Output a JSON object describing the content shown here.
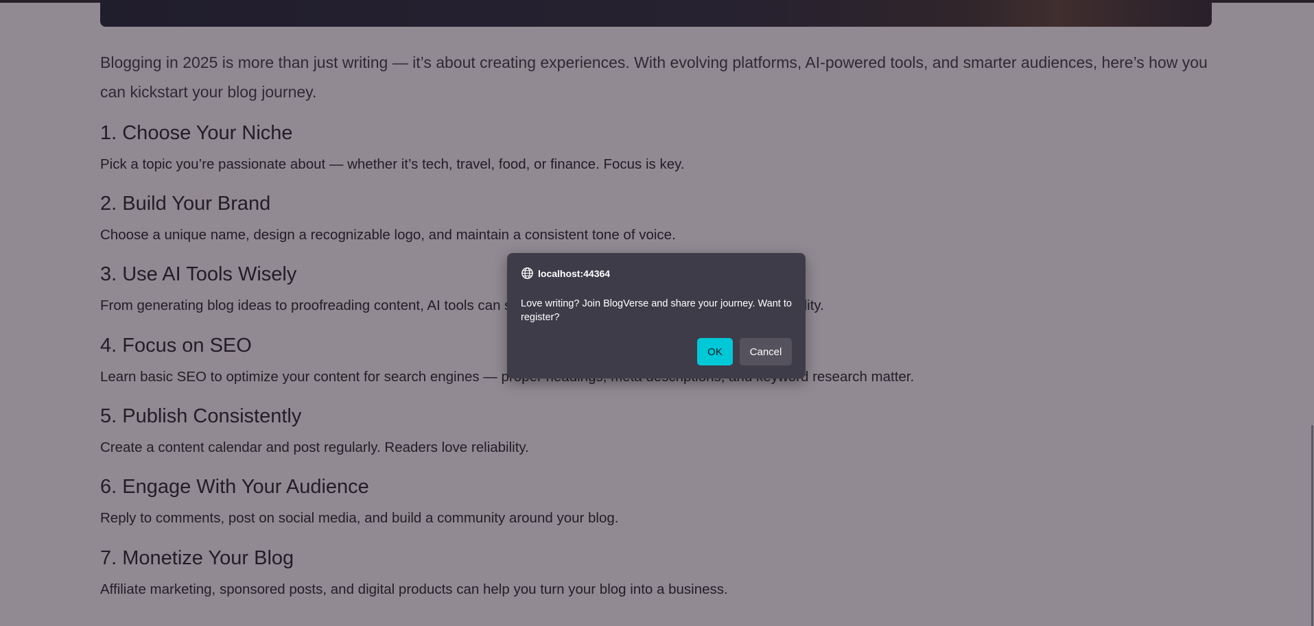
{
  "article": {
    "intro": "Blogging in 2025 is more than just writing — it’s about creating experiences. With evolving platforms, AI-powered tools, and smarter audiences, here’s how you can kickstart your blog journey.",
    "sections": [
      {
        "heading": "1. Choose Your Niche",
        "text": "Pick a topic you’re passionate about — whether it’s tech, travel, food, or finance. Focus is key."
      },
      {
        "heading": "2. Build Your Brand",
        "text": "Choose a unique name, design a recognizable logo, and maintain a consistent tone of voice."
      },
      {
        "heading": "3. Use AI Tools Wisely",
        "text": "From generating blog ideas to proofreading content, AI tools can significantly improve your writing speed and quality."
      },
      {
        "heading": "4. Focus on SEO",
        "text": "Learn basic SEO to optimize your content for search engines — proper headings, meta descriptions, and keyword research matter."
      },
      {
        "heading": "5. Publish Consistently",
        "text": "Create a content calendar and post regularly. Readers love reliability."
      },
      {
        "heading": "6. Engage With Your Audience",
        "text": "Reply to comments, post on social media, and build a community around your blog."
      },
      {
        "heading": "7. Monetize Your Blog",
        "text": "Affiliate marketing, sponsored posts, and digital products can help you turn your blog into a business."
      }
    ]
  },
  "dialog": {
    "origin": "localhost:44364",
    "origin_icon": "globe-icon",
    "message": "Love writing? Join BlogVerse and share your journey. Want to register?",
    "ok_label": "OK",
    "cancel_label": "Cancel"
  },
  "colors": {
    "overlay": "#261626",
    "dialog_bg": "#3f3c4a",
    "ok_button": "#00c8d7",
    "cancel_button": "#55525e"
  }
}
